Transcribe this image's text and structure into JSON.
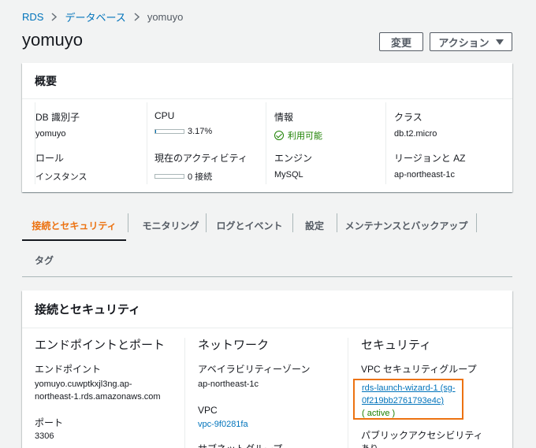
{
  "breadcrumb": [
    "RDS",
    "データベース",
    "yomuyo"
  ],
  "title": "yomuyo",
  "buttons": {
    "edit": "変更",
    "actions": "アクション"
  },
  "summary": {
    "header": "概要",
    "db_id_label": "DB 識別子",
    "db_id": "yomuyo",
    "role_label": "ロール",
    "role": "インスタンス",
    "cpu_label": "CPU",
    "cpu": "3.17%",
    "cpu_fraction": 0.0317,
    "activity_label": "現在のアクティビティ",
    "activity": "0 接続",
    "activity_fraction": 0,
    "info_label": "情報",
    "info": "利用可能",
    "engine_label": "エンジン",
    "engine": "MySQL",
    "class_label": "クラス",
    "class": "db.t2.micro",
    "region_label": "リージョンと AZ",
    "region": "ap-northeast-1c"
  },
  "tabs": [
    "接続とセキュリティ",
    "モニタリング",
    "ログとイベント",
    "設定",
    "メンテナンスとバックアップ",
    "タグ"
  ],
  "connection": {
    "header": "接続とセキュリティ",
    "endpoint_section": "エンドポイントとポート",
    "endpoint_label": "エンドポイント",
    "endpoint_line1": "yomuyo.cuwptkxjl3ng.ap-",
    "endpoint_line2": "northeast-1.rds.amazonaws.com",
    "port_label": "ポート",
    "port": "3306",
    "network_section": "ネットワーク",
    "az_label": "アベイラビリティーゾーン",
    "az": "ap-northeast-1c",
    "vpc_label": "VPC",
    "vpc": "vpc-9f0281fa",
    "subnet_label": "サブネットグループ",
    "security_section": "セキュリティ",
    "sg_label": "VPC セキュリティグループ",
    "sg_line1": "rds-launch-wizard-1 (sg-",
    "sg_line2": "0f219bb2761793e4c)",
    "sg_status": "( active )",
    "public_label": "パブリックアクセシビリティ",
    "public": "あり"
  },
  "colors": {
    "accent": "#ec7211",
    "link": "#0073bb",
    "success": "#1d8102"
  }
}
